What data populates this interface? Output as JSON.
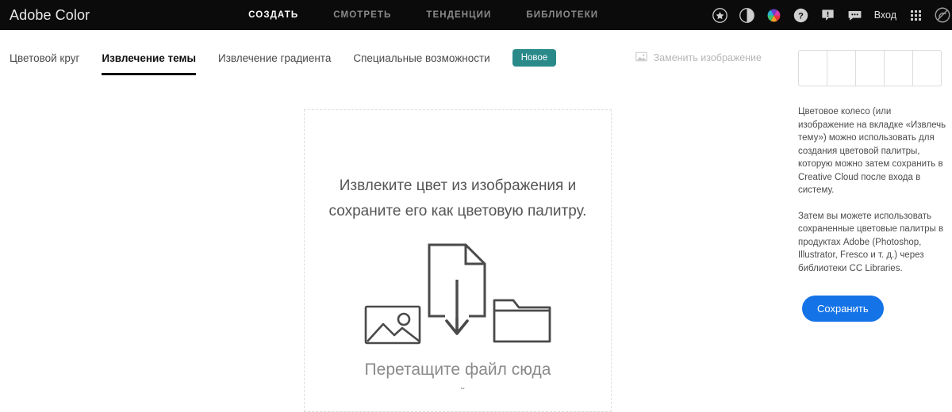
{
  "header": {
    "brand": "Adobe Color",
    "nav": [
      {
        "label": "СОЗДАТЬ",
        "active": true
      },
      {
        "label": "СМОТРЕТЬ",
        "active": false
      },
      {
        "label": "ТЕНДЕНЦИИ",
        "active": false
      },
      {
        "label": "БИБЛИОТЕКИ",
        "active": false
      }
    ],
    "icons": [
      "star-icon",
      "contrast-icon",
      "color-wheel-icon",
      "help-icon",
      "feedback-icon",
      "chat-icon"
    ],
    "signin_label": "Вход",
    "app_grid_icon": "app-grid-icon",
    "creative_cloud_icon": "creative-cloud-icon",
    "background_color": "#0b0b0b"
  },
  "tabs": [
    {
      "label": "Цветовой круг",
      "active": false
    },
    {
      "label": "Извлечение темы",
      "active": true
    },
    {
      "label": "Извлечение градиента",
      "active": false
    },
    {
      "label": "Специальные возможности",
      "active": false
    }
  ],
  "new_badge": {
    "label": "Новое",
    "color": "#2a8a8a"
  },
  "replace_image": {
    "label": "Заменить изображение",
    "icon": "image-icon"
  },
  "dropzone": {
    "heading": "Извлеките цвет из изображения и сохраните его как цветовую палитру.",
    "subtext": "Перетащите файл сюда",
    "clipped_text": "или найдите",
    "icons": [
      "image-icon",
      "document-download-icon",
      "folder-icon"
    ]
  },
  "sidebar": {
    "swatch_count": 5,
    "paragraphs": [
      "Цветовое колесо (или изображение на вкладке «Извлечь тему») можно использовать для создания цветовой палитры, которую можно затем сохранить в Creative Cloud после входа в систему.",
      "Затем вы можете использовать сохраненные цветовые палитры в продуктах Adobe (Photoshop, Illustrator, Fresco и т. д.) через библиотеки CC Libraries."
    ],
    "save_label": "Сохранить",
    "save_color": "#1473e6"
  }
}
